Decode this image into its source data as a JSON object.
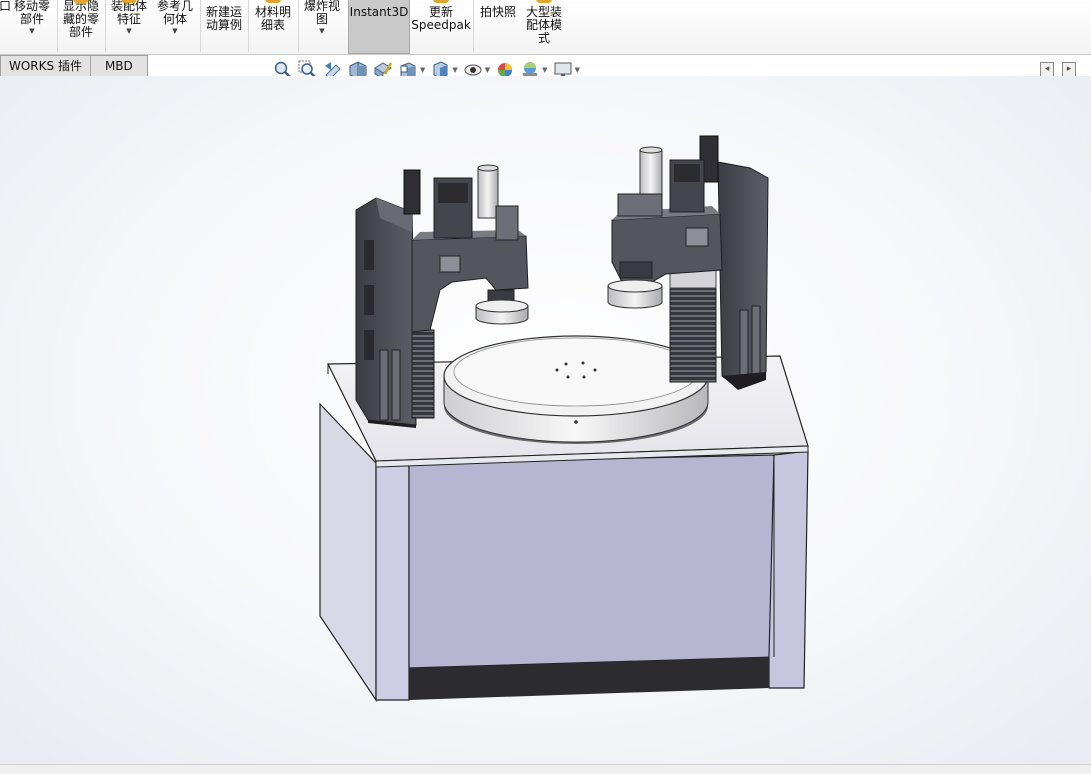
{
  "ribbon": {
    "items": [
      {
        "label": "装配体\n特征",
        "dropdown": true
      },
      {
        "label": "参考几\n何体",
        "dropdown": true
      },
      {
        "label": "新建运\n动算例",
        "dropdown": false
      },
      {
        "label": "材料明\n细表",
        "dropdown": false
      },
      {
        "label": "爆炸视\n图",
        "dropdown": true
      },
      {
        "label": "Instant3D",
        "dropdown": false
      },
      {
        "label": "更新\nSpeedpak",
        "dropdown": false
      },
      {
        "label": "拍快照",
        "dropdown": false
      },
      {
        "label": "大型装\n配体模\n式",
        "dropdown": false
      }
    ],
    "left_partial_label": "口",
    "move_component_label": "移动零\n部件",
    "show_hidden_label": "显示隐\n藏的零\n部件"
  },
  "tabs": [
    "WORKS 插件",
    "MBD"
  ],
  "view_toolbar": {
    "icons": [
      "zoom-to-fit-icon",
      "zoom-to-area-icon",
      "previous-view-icon",
      "section-view-icon",
      "dynamic-annotation-icon",
      "view-orientation-icon",
      "display-style-icon",
      "hide-show-items-icon",
      "edit-appearance-icon",
      "apply-scene-icon",
      "view-settings-icon"
    ]
  },
  "colors": {
    "viewport_bg": "#f4f5f8",
    "cabinet": "#b8b5d2",
    "table_top": "#ffffff",
    "dark_part": "#4a4a52"
  }
}
